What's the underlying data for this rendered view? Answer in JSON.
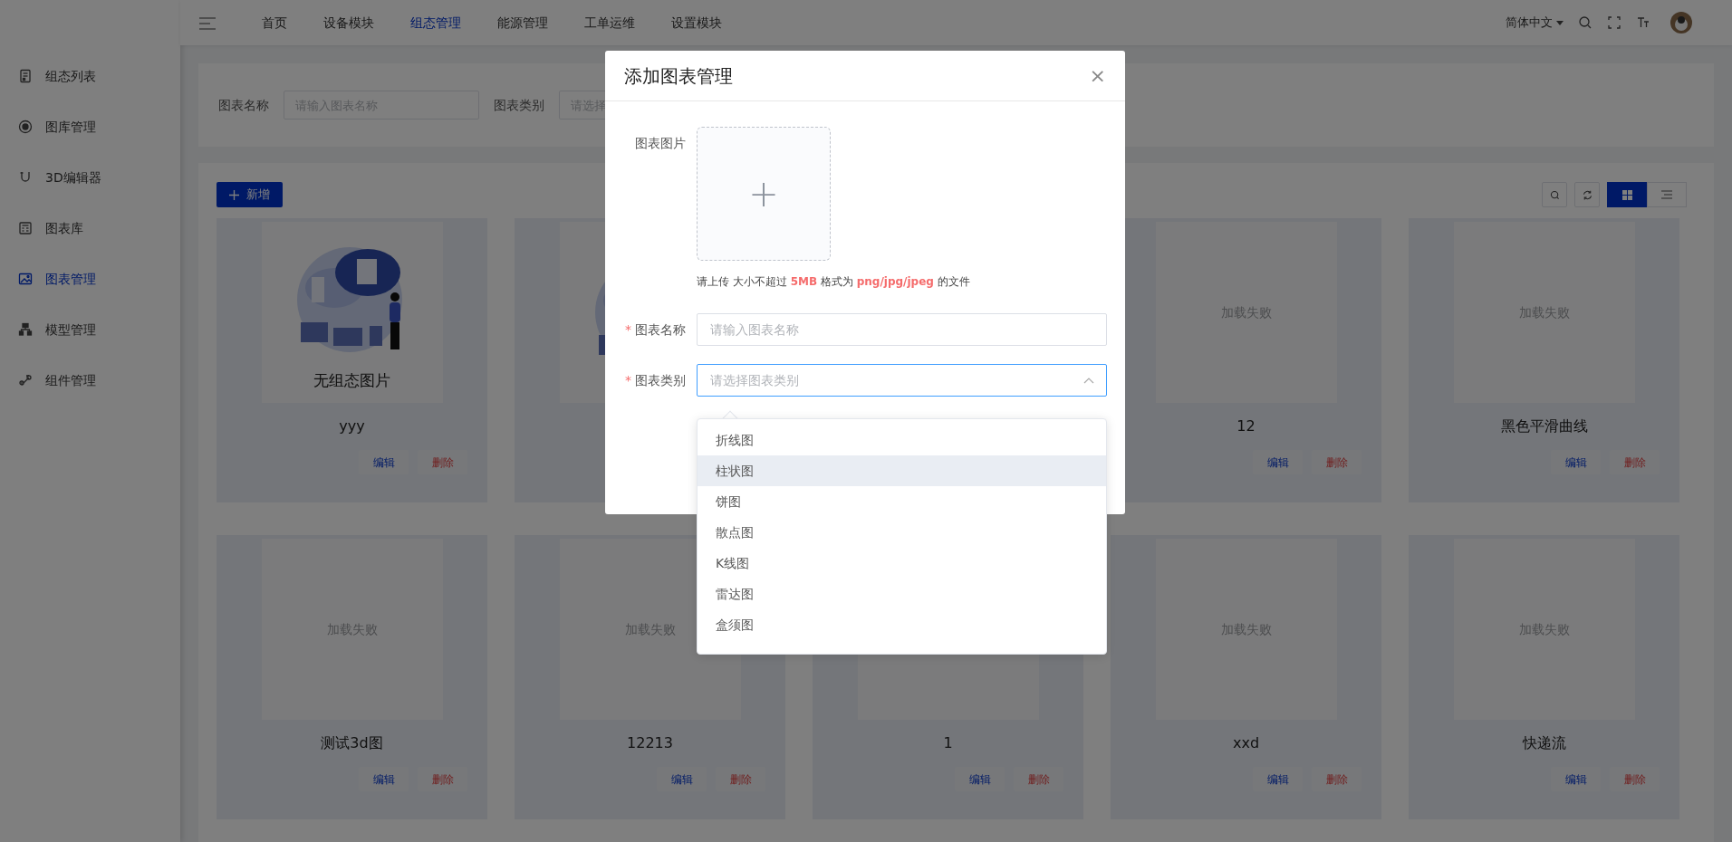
{
  "sidebar": {
    "items": [
      {
        "label": "组态列表",
        "selected": false
      },
      {
        "label": "图库管理",
        "selected": false
      },
      {
        "label": "3D编辑器",
        "selected": false
      },
      {
        "label": "图表库",
        "selected": false
      },
      {
        "label": "图表管理",
        "selected": true
      },
      {
        "label": "模型管理",
        "selected": false
      },
      {
        "label": "组件管理",
        "selected": false
      }
    ]
  },
  "header": {
    "nav": [
      {
        "label": "首页",
        "selected": false
      },
      {
        "label": "设备模块",
        "selected": false
      },
      {
        "label": "组态管理",
        "selected": true
      },
      {
        "label": "能源管理",
        "selected": false
      },
      {
        "label": "工单运维",
        "selected": false
      },
      {
        "label": "设置模块",
        "selected": false
      }
    ],
    "language": "简体中文"
  },
  "filters": [
    {
      "label": "图表名称",
      "placeholder": "请输入图表名称"
    },
    {
      "label": "图表类别",
      "placeholder": "请选择"
    }
  ],
  "toolbar": {
    "add_button": "新增",
    "views": [
      {
        "kind": "grid",
        "selected": true
      },
      {
        "kind": "list",
        "selected": false
      }
    ]
  },
  "cards": [
    {
      "kind": "illustration",
      "caption": "无组态图片",
      "title": "yyy",
      "edit": "编辑",
      "delete": "删除"
    },
    {
      "kind": "illustration"
    },
    {
      "kind": "covered"
    },
    {
      "kind": "empty",
      "status_text": "加载失败",
      "title": "12",
      "edit": "编辑",
      "delete": "删除"
    },
    {
      "kind": "empty",
      "status_text": "加载失败",
      "title": "黑色平滑曲线",
      "edit": "编辑",
      "delete": "删除"
    },
    {
      "kind": "empty",
      "status_text": "加载失败",
      "title": "测试3d图",
      "edit": "编辑",
      "delete": "删除"
    },
    {
      "kind": "empty",
      "status_text": "加载失败",
      "title": "12213",
      "edit": "编辑",
      "delete": "删除"
    },
    {
      "kind": "empty",
      "title": "1",
      "edit": "编辑",
      "delete": "删除"
    },
    {
      "kind": "empty",
      "status_text": "加载失败",
      "title": "xxd",
      "edit": "编辑",
      "delete": "删除"
    },
    {
      "kind": "empty",
      "status_text": "加载失败",
      "title": "快递流",
      "edit": "编辑",
      "delete": "删除"
    }
  ],
  "dialog": {
    "title": "添加图表管理",
    "close": "×",
    "upload": {
      "label": "图表图片",
      "plus": "+",
      "hint": "请上传 大小不超过 **5MB** 格式为 **png/jpg/jpeg** 的文件"
    },
    "fields": [
      {
        "kind": "input",
        "label": "图表名称",
        "required": true,
        "required_mark": "*",
        "placeholder": "请输入图表名称",
        "focused": false
      },
      {
        "kind": "select",
        "label": "图表类别",
        "required": true,
        "required_mark": "*",
        "placeholder": "请选择图表类别",
        "focused": true,
        "expanded": true
      }
    ],
    "options": [
      {
        "label": "折线图",
        "hovered": false
      },
      {
        "label": "柱状图",
        "hovered": true
      },
      {
        "label": "饼图",
        "hovered": false
      },
      {
        "label": "散点图",
        "hovered": false
      },
      {
        "label": "K线图",
        "hovered": false
      },
      {
        "label": "雷达图",
        "hovered": false
      },
      {
        "label": "盒须图",
        "hovered": false
      }
    ]
  }
}
